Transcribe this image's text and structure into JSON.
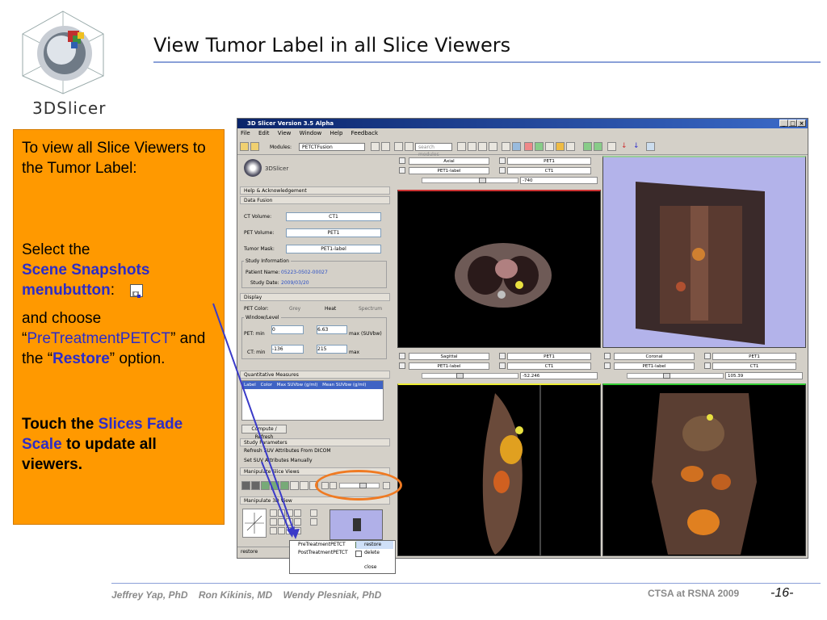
{
  "slide": {
    "title": "View Tumor Label in all Slice Viewers",
    "logo_text": "3DSlicer",
    "instructions": {
      "p1": "To view all Slice Viewers to the Tumor Label:",
      "p2_pre": "Select the",
      "p2_highlight": "Scene Snapshots menubutton",
      "p2_post": ":",
      "p3_pre": "and choose “",
      "p3_highlight1": "PreTreatmentPETCT",
      "p3_mid": "” and the “",
      "p3_highlight2": "Restore",
      "p3_post": "” option.",
      "p4_pre": "Touch the",
      "p4_highlight": "Slices Fade Scale",
      "p4_post": "to update all viewers."
    },
    "footer": {
      "authors": "Jeffrey Yap, PhD    Ron Kikinis, MD    Wendy Plesniak, PhD",
      "conference": "CTSA at RSNA 2009",
      "page": "-16-"
    }
  },
  "app": {
    "window_title": "3D Slicer Version 3.5 Alpha",
    "menu": [
      "File",
      "Edit",
      "View",
      "Window",
      "Help",
      "Feedback"
    ],
    "modules_label": "Modules:",
    "module_value": "PETCTFusion",
    "search_placeholder": "search modules",
    "logo": "3DSlicer",
    "sections": {
      "help": "Help & Acknowledgement",
      "data_fusion": "Data Fusion",
      "display": "Display",
      "quant": "Quantitative Measures",
      "study_params": "Study Parameters",
      "manip_slice": "Manipulate Slice Views",
      "manip_3d": "Manipulate 3D View"
    },
    "data_fusion": {
      "ct_label": "CT Volume:",
      "ct_value": "CT1",
      "pet_label": "PET Volume:",
      "pet_value": "PET1",
      "tumor_label": "Tumor Mask:",
      "tumor_value": "PET1-label",
      "study_info": "Study Information",
      "patient_label": "Patient Name:",
      "patient_value": "05223-0502-00027",
      "date_label": "Study Date:",
      "date_value": "2009/03/20"
    },
    "display": {
      "pet_color": "PET Color:",
      "grey": "Grey",
      "heat": "Heat",
      "spectrum": "Spectrum",
      "window_level": "Window/Level",
      "pet_min_label": "PET:  min",
      "pet_min": "0",
      "pet_max": "6.63",
      "pet_max_unit": "max (SUVbw)",
      "ct_min_label": "CT:  min",
      "ct_min": "-136",
      "ct_max": "215",
      "ct_max_label": "max"
    },
    "quant": {
      "columns": [
        "Label",
        "Color",
        "Max SUVbw (g/ml)",
        "Mean SUVbw (g/ml)"
      ],
      "compute": "Compute / Refresh"
    },
    "study_params": {
      "refresh": "Refresh SUV Attributes From DICOM",
      "set": "Set SUV Attributes Manually"
    },
    "status": "restore",
    "viewers": {
      "axial": {
        "orient": "Axial",
        "fg": "PET1",
        "label": "PET1-label",
        "bg": "CT1",
        "offset": "-740"
      },
      "sagittal": {
        "orient": "Sagittal",
        "fg": "PET1",
        "label": "PET1-label",
        "bg": "CT1",
        "offset": "-52.246"
      },
      "coronal": {
        "orient": "Coronal",
        "fg": "PET1",
        "label": "PET1-label",
        "bg": "CT1",
        "offset": "105.39"
      }
    },
    "popup": {
      "item1": "PreTreatmentPETCT",
      "item2": "PostTreatmentPETCT",
      "restore": "restore",
      "delete": "delete",
      "close": "close"
    }
  },
  "colors": {
    "panel_bg": "#ff9900",
    "accent_blue": "#2c2cc8",
    "highlight_circle": "#ef7a22",
    "arrow": "#3a3ac8"
  }
}
